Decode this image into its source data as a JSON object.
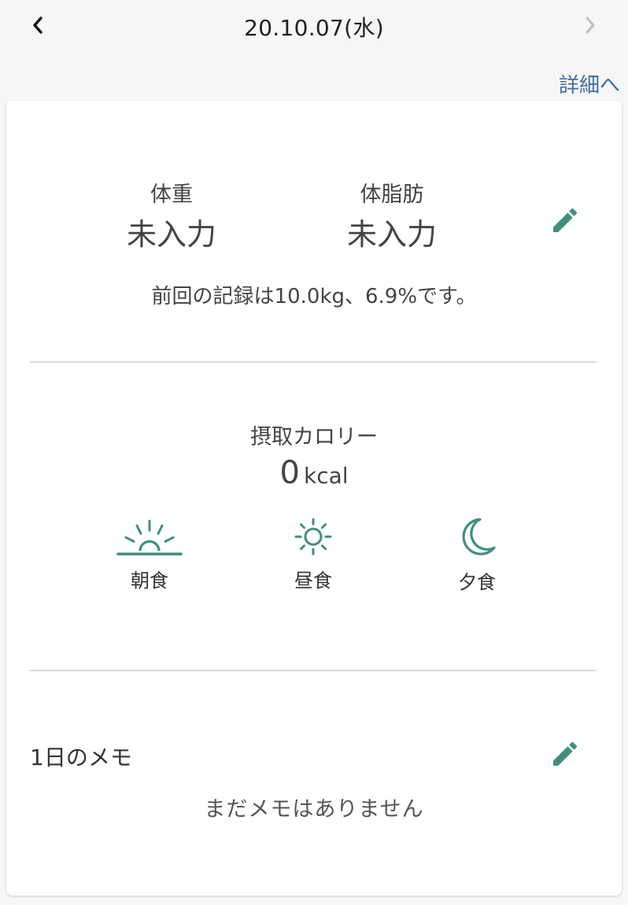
{
  "header": {
    "date": "20.10.07(水)",
    "detail_link": "詳細へ"
  },
  "body_metrics": {
    "weight": {
      "label": "体重",
      "value": "未入力"
    },
    "body_fat": {
      "label": "体脂肪",
      "value": "未入力"
    },
    "previous_record": "前回の記録は10.0kg、6.9%です。"
  },
  "calories": {
    "label": "摂取カロリー",
    "value": "0",
    "unit": "kcal",
    "meals": [
      {
        "label": "朝食",
        "icon": "sunrise-icon"
      },
      {
        "label": "昼食",
        "icon": "sun-icon"
      },
      {
        "label": "夕食",
        "icon": "moon-icon"
      }
    ]
  },
  "memo": {
    "title": "1日のメモ",
    "empty_text": "まだメモはありません"
  },
  "colors": {
    "accent": "#3f8f80",
    "link": "#3f6ea3",
    "background": "#f6f6f6",
    "card": "#ffffff",
    "divider": "#d9d9d9"
  }
}
